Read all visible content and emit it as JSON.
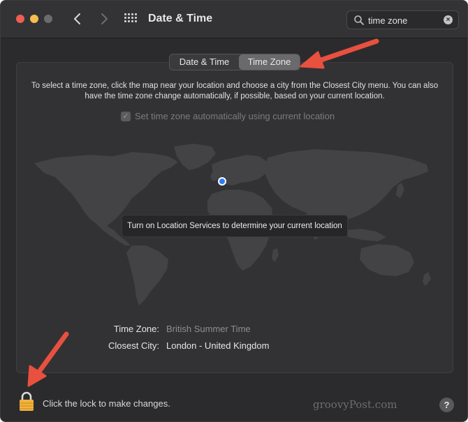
{
  "window": {
    "title": "Date & Time",
    "controls": [
      "close",
      "minimize",
      "maximize"
    ]
  },
  "toolbar": {
    "back_icon": "chevron-left-icon",
    "forward_icon": "chevron-right-icon",
    "grid_icon": "show-all-grid-icon"
  },
  "search": {
    "value": "time zone",
    "clear": "×"
  },
  "tabs": [
    {
      "label": "Date & Time",
      "selected": false
    },
    {
      "label": "Time Zone",
      "selected": true
    }
  ],
  "time_zone": {
    "instructions": "To select a time zone, click the map near your location and choose a city from the Closest City menu. You can also have the time zone change automatically, if possible, based on your current location.",
    "auto_checkbox_mark": "✓",
    "auto_label": "Set time zone automatically using current location",
    "tooltip": "Turn on Location Services to determine your current location",
    "tz_label": "Time Zone:",
    "tz_value": "British Summer Time",
    "city_label": "Closest City:",
    "city_value": "London - United Kingdom"
  },
  "footer": {
    "lock_label": "Click the lock to make changes.",
    "help": "?",
    "watermark": "groovyPost.com"
  },
  "colors": {
    "window_bg": "#2b2b2d",
    "selected_tab": "#6a6a6c",
    "location_pin": "#2c7cf6",
    "annotation_arrow": "#e8503f",
    "lock_gold": "#f2b33d"
  }
}
